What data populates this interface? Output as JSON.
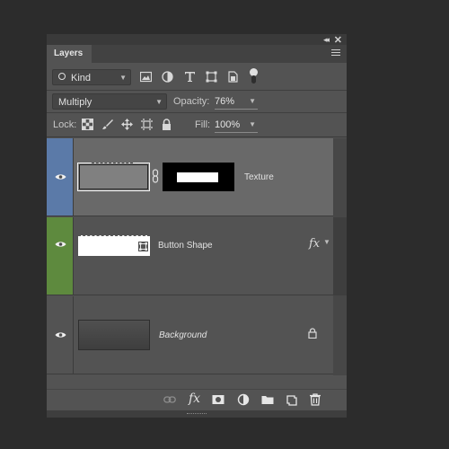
{
  "panel": {
    "tab_label": "Layers",
    "collapse_glyph": "◂◂",
    "close_glyph": "✕"
  },
  "filter": {
    "kind_label": "Kind",
    "icons": [
      "search-icon",
      "image-filter-icon",
      "adjustment-filter-icon",
      "type-filter-icon",
      "shape-filter-icon",
      "smart-object-filter-icon",
      "filter-toggle"
    ]
  },
  "blend": {
    "mode": "Multiply",
    "opacity_label": "Opacity:",
    "opacity_value": "76%"
  },
  "lock": {
    "label": "Lock:",
    "fill_label": "Fill:",
    "fill_value": "100%"
  },
  "layers": [
    {
      "name": "Texture",
      "selected": true,
      "strip_color": "#5b7aa8",
      "has_mask": true
    },
    {
      "name": "Button Shape",
      "strip_color": "#5e8a3e",
      "fx": "fx"
    },
    {
      "name": "Background",
      "italic": true,
      "locked": true
    }
  ],
  "bottom_bar": {
    "fx_label": "fx",
    "icons": [
      "link-icon",
      "fx-icon",
      "mask-icon",
      "adjustment-icon",
      "folder-icon",
      "new-layer-icon",
      "trash-icon"
    ]
  }
}
